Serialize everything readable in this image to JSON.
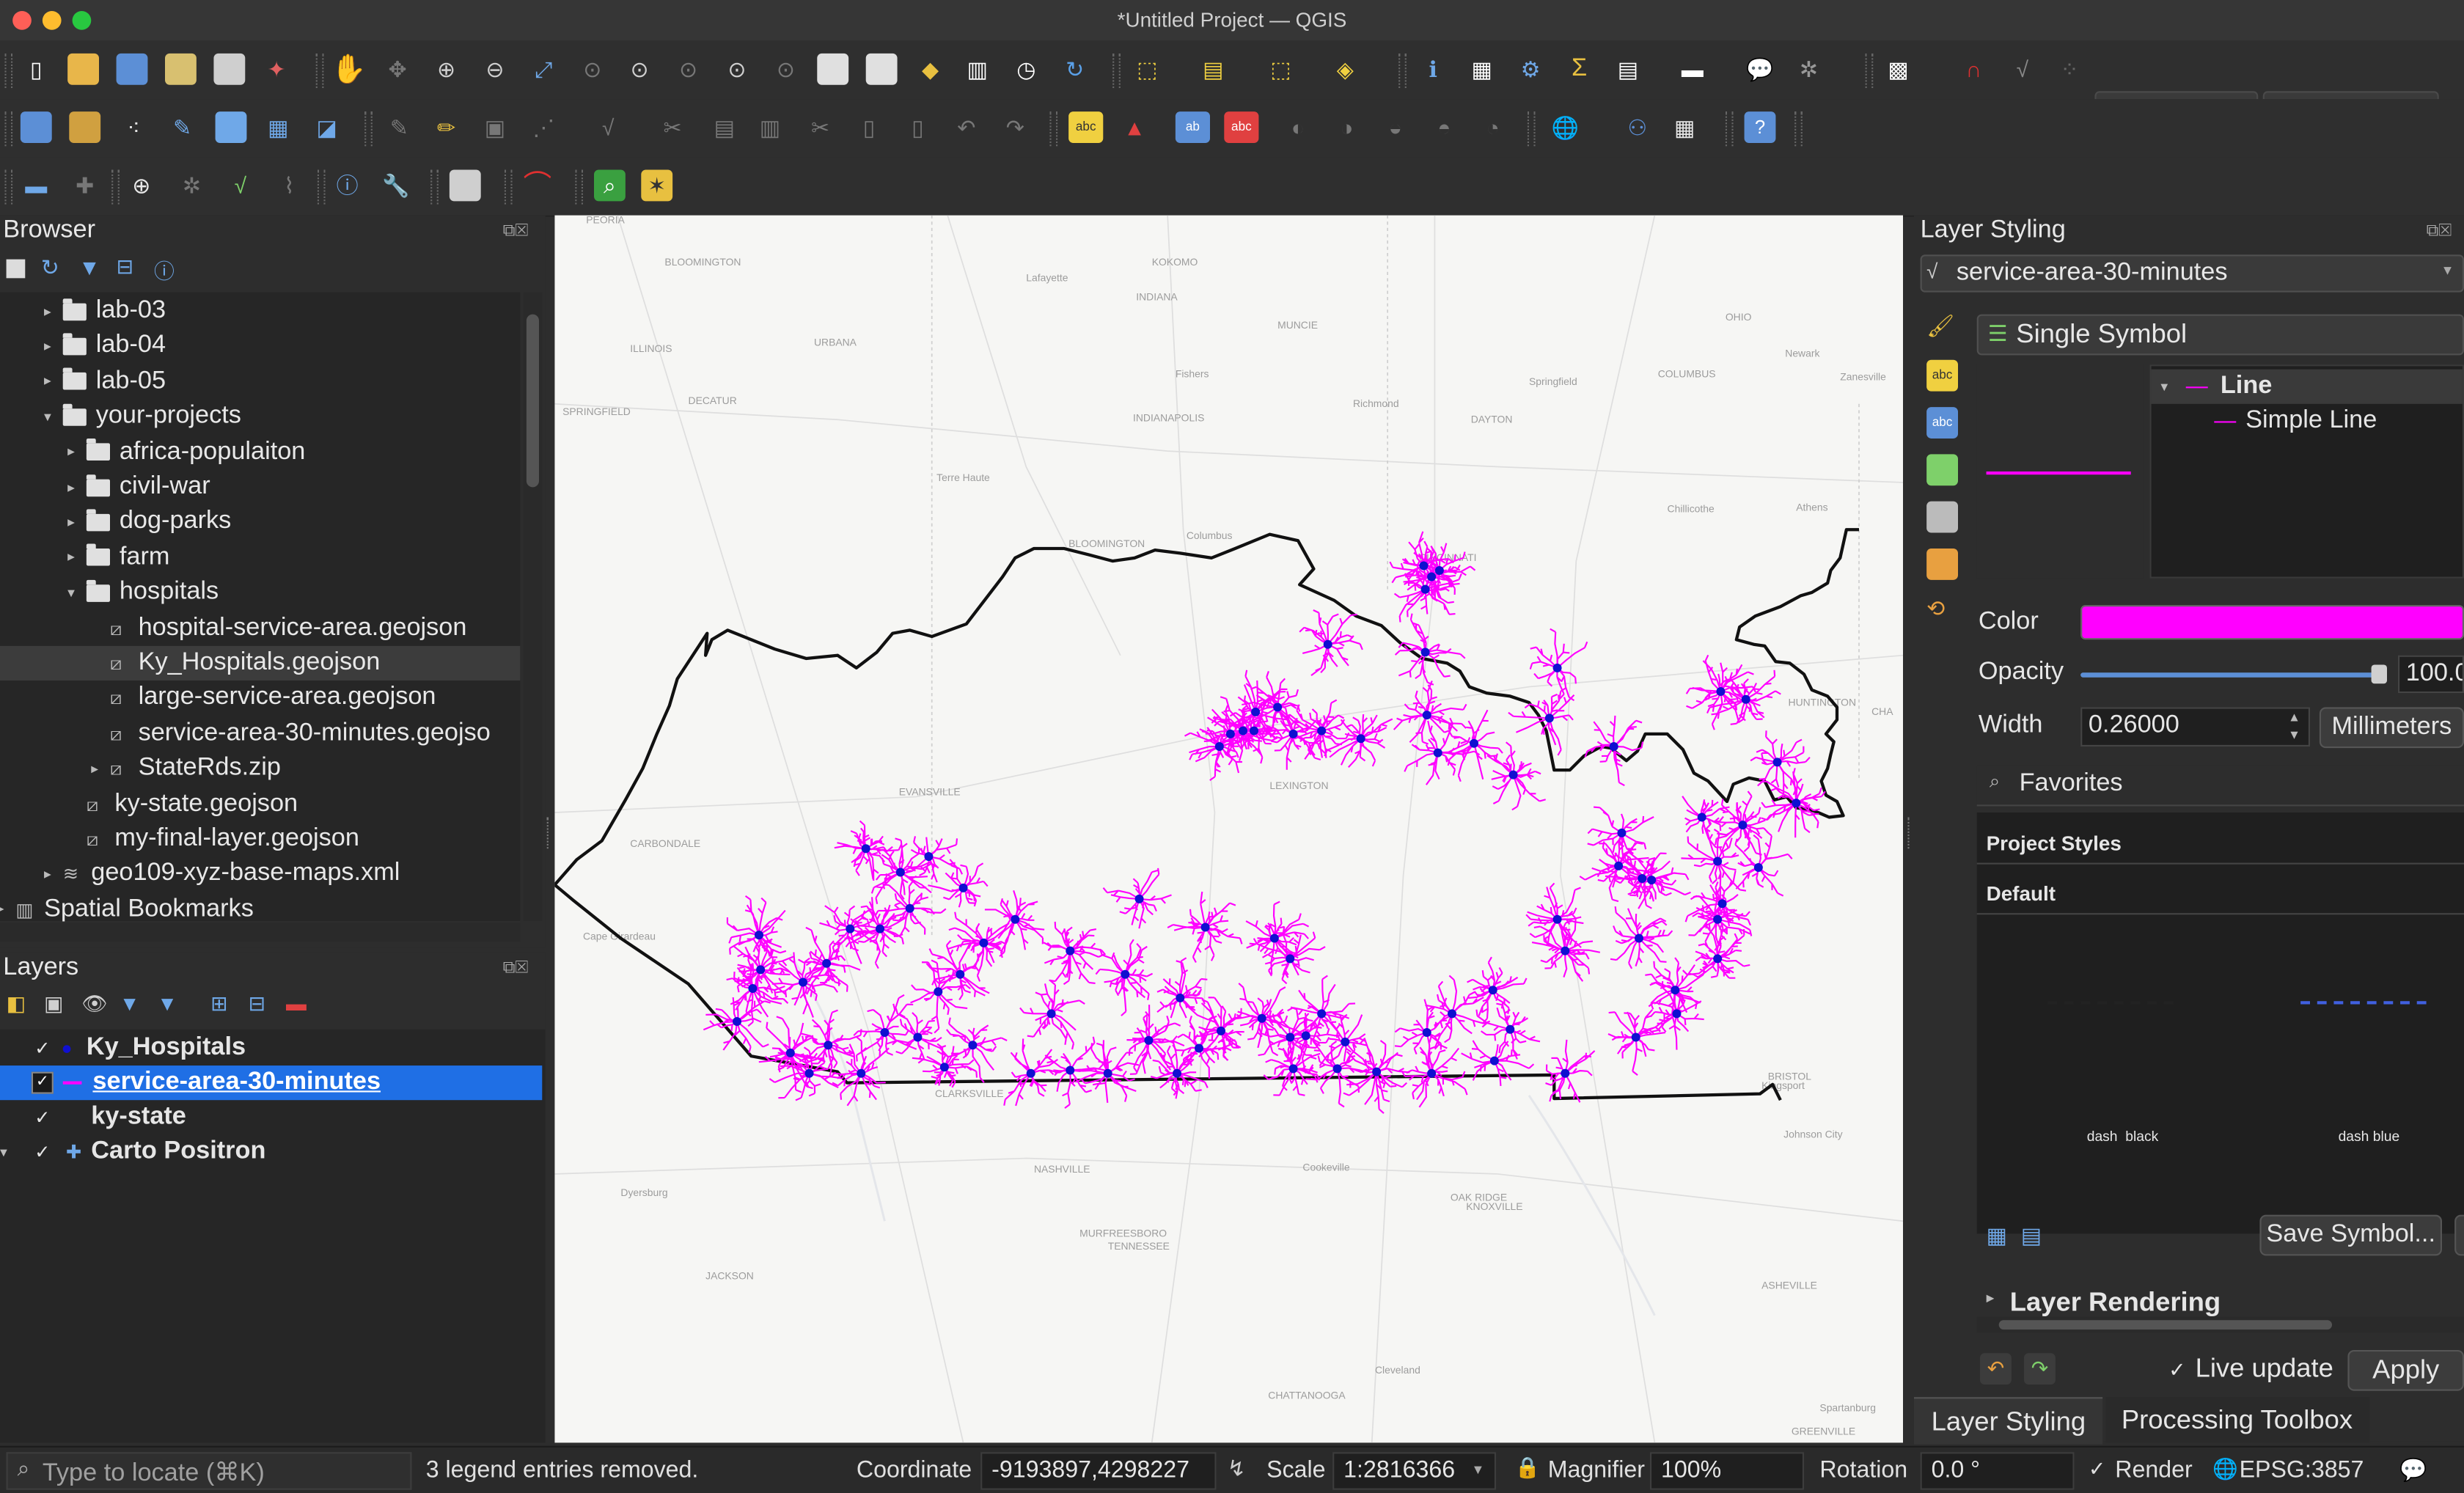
{
  "window": {
    "title": "*Untitled Project — QGIS"
  },
  "toolbar": {
    "font_size_value": "12",
    "font_unit": "px"
  },
  "browser": {
    "title": "Browser",
    "items": [
      {
        "label": "lab-03",
        "type": "folder",
        "indent": 0,
        "expand": "closed"
      },
      {
        "label": "lab-04",
        "type": "folder",
        "indent": 0,
        "expand": "closed"
      },
      {
        "label": "lab-05",
        "type": "folder",
        "indent": 0,
        "expand": "closed"
      },
      {
        "label": "your-projects",
        "type": "folder",
        "indent": 0,
        "expand": "open"
      },
      {
        "label": "africa-populaiton",
        "type": "folder",
        "indent": 1,
        "expand": "closed"
      },
      {
        "label": "civil-war",
        "type": "folder",
        "indent": 1,
        "expand": "closed"
      },
      {
        "label": "dog-parks",
        "type": "folder",
        "indent": 1,
        "expand": "closed"
      },
      {
        "label": "farm",
        "type": "folder",
        "indent": 1,
        "expand": "closed"
      },
      {
        "label": "hospitals",
        "type": "folder",
        "indent": 1,
        "expand": "open"
      },
      {
        "label": "hospital-service-area.geojson",
        "type": "file",
        "indent": 2,
        "expand": "none"
      },
      {
        "label": "Ky_Hospitals.geojson",
        "type": "file",
        "indent": 2,
        "expand": "none"
      },
      {
        "label": "large-service-area.geojson",
        "type": "file",
        "indent": 2,
        "expand": "none"
      },
      {
        "label": "service-area-30-minutes.geojso",
        "type": "file",
        "indent": 2,
        "expand": "none"
      },
      {
        "label": "StateRds.zip",
        "type": "file",
        "indent": 2,
        "expand": "closed"
      },
      {
        "label": "ky-state.geojson",
        "type": "file",
        "indent": 1,
        "expand": "none"
      },
      {
        "label": "my-final-layer.geojson",
        "type": "file",
        "indent": 1,
        "expand": "none"
      },
      {
        "label": "geo109-xyz-base-maps.xml",
        "type": "db",
        "indent": 0,
        "expand": "closed"
      },
      {
        "label": "Spatial Bookmarks",
        "type": "bookmark",
        "indent": -1,
        "expand": "closed"
      }
    ]
  },
  "layers": {
    "title": "Layers",
    "items": [
      {
        "label": "Ky_Hospitals",
        "checked": true,
        "symbol": "point"
      },
      {
        "label": "service-area-30-minutes",
        "checked": true,
        "symbol": "line"
      },
      {
        "label": "ky-state",
        "checked": true,
        "symbol": "poly"
      },
      {
        "label": "Carto Positron",
        "checked": true,
        "symbol": "xyz"
      }
    ]
  },
  "map_labels": [
    {
      "text": "PEORIA"
    },
    {
      "text": "BLOOMINGTON"
    },
    {
      "text": "KOKOMO"
    },
    {
      "text": "Lafayette"
    },
    {
      "text": "INDIANA"
    },
    {
      "text": "MUNCIE"
    },
    {
      "text": "OHIO"
    },
    {
      "text": "ILLINOIS"
    },
    {
      "text": "URBANA"
    },
    {
      "text": "Fishers"
    },
    {
      "text": "Springfield"
    },
    {
      "text": "COLUMBUS"
    },
    {
      "text": "Newark"
    },
    {
      "text": "Zanesville"
    },
    {
      "text": "SPRINGFIELD"
    },
    {
      "text": "DECATUR"
    },
    {
      "text": "INDIANAPOLIS"
    },
    {
      "text": "Richmond"
    },
    {
      "text": "DAYTON"
    },
    {
      "text": "Terre Haute"
    },
    {
      "text": "Chillicothe"
    },
    {
      "text": "Athens"
    },
    {
      "text": "BLOOMINGTON"
    },
    {
      "text": "Columbus"
    },
    {
      "text": "EVANSVILLE"
    },
    {
      "text": "CARBONDALE"
    },
    {
      "text": "HUNTINGTON"
    },
    {
      "text": "Cape Girardeau"
    },
    {
      "text": "CLARKSVILLE"
    },
    {
      "text": "Kingsport"
    },
    {
      "text": "BRISTOL"
    },
    {
      "text": "Johnson City"
    },
    {
      "text": "NASHVILLE"
    },
    {
      "text": "Cookeville"
    },
    {
      "text": "Dyersburg"
    },
    {
      "text": "OAK RIDGE"
    },
    {
      "text": "KNOXVILLE"
    },
    {
      "text": "MURFREESBORO"
    },
    {
      "text": "TENNESSEE"
    },
    {
      "text": "JACKSON"
    },
    {
      "text": "ASHEVILLE"
    },
    {
      "text": "Cleveland"
    },
    {
      "text": "CHATTANOOGA"
    },
    {
      "text": "Spartanburg"
    },
    {
      "text": "GREENVILLE"
    },
    {
      "text": "CINCINNATI"
    },
    {
      "text": "LEXINGTON"
    },
    {
      "text": "CHA"
    }
  ],
  "styling": {
    "title": "Layer Styling",
    "layer_select": "service-area-30-minutes",
    "renderer": "Single Symbol",
    "symbol_tree_root": "Line",
    "symbol_tree_child": "Simple Line",
    "color_label": "Color",
    "color_value": "#ff00ff",
    "opacity_label": "Opacity",
    "opacity_value": "100.0",
    "opacity_fraction": 1.0,
    "width_label": "Width",
    "width_value": "0.26000",
    "width_unit": "Millimeters",
    "search_placeholder": "Favorites",
    "group_project": "Project Styles",
    "group_default": "Default",
    "swatch1": "dash  black",
    "swatch2": "dash blue",
    "save_symbol": "Save Symbol...",
    "layer_rendering": "Layer Rendering",
    "live_update": "Live update",
    "apply": "Apply",
    "tab_styling": "Layer Styling",
    "tab_processing": "Processing Toolbox"
  },
  "status": {
    "locate_placeholder": "Type to locate (⌘K)",
    "message": "3 legend entries removed.",
    "coordinate_label": "Coordinate",
    "coordinate_value": "-9193897,4298227",
    "scale_label": "Scale",
    "scale_value": "1:2816366",
    "magnifier_label": "Magnifier",
    "magnifier_value": "100%",
    "rotation_label": "Rotation",
    "rotation_value": "0.0 °",
    "render_label": "Render",
    "crs": "EPSG:3857"
  },
  "colors": {
    "service_area": "#ff00ff",
    "hospital": "#1010d0",
    "selection": "#1f6fe5",
    "state_outline": "#111111"
  }
}
